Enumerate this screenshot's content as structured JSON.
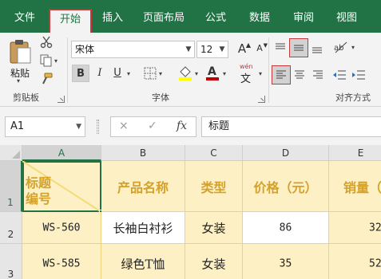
{
  "tabs": [
    {
      "label": "文件",
      "active": false
    },
    {
      "label": "开始",
      "active": true
    },
    {
      "label": "插入",
      "active": false
    },
    {
      "label": "页面布局",
      "active": false
    },
    {
      "label": "公式",
      "active": false
    },
    {
      "label": "数据",
      "active": false
    },
    {
      "label": "审阅",
      "active": false
    },
    {
      "label": "视图",
      "active": false
    }
  ],
  "clipboard": {
    "paste_label": "粘贴",
    "group_label": "剪贴板"
  },
  "font": {
    "name": "宋体",
    "size": "12",
    "group_label": "字体",
    "bold": "B",
    "italic": "I",
    "underline": "U",
    "grow": "A",
    "shrink": "A",
    "wen": "wén",
    "fill_color": "#ffff00",
    "font_color": "#c00000"
  },
  "alignment": {
    "group_label": "对齐方式"
  },
  "formula_bar": {
    "name_box": "A1",
    "cancel": "×",
    "enter": "✓",
    "fx": "fx",
    "content": "标题"
  },
  "columns": [
    "A",
    "B",
    "C",
    "D",
    "E"
  ],
  "rows": [
    "1",
    "2",
    "3"
  ],
  "cells": {
    "a1_top": "标题",
    "a1_bottom": "编号",
    "b1": "产品名称",
    "c1": "类型",
    "d1": "价格（元）",
    "e1": "销量（",
    "a2": "WS-560",
    "b2": "长袖白衬衫",
    "c2": "女装",
    "d2": "86",
    "e2": "32",
    "a3": "WS-585",
    "b3": "绿色T恤",
    "c3": "女装",
    "d3": "35",
    "e3": "52"
  },
  "colors": {
    "accent": "#217346",
    "highlight": "#c0393b",
    "header_fill": "#fdf0c4",
    "header_text": "#d4a12a"
  }
}
